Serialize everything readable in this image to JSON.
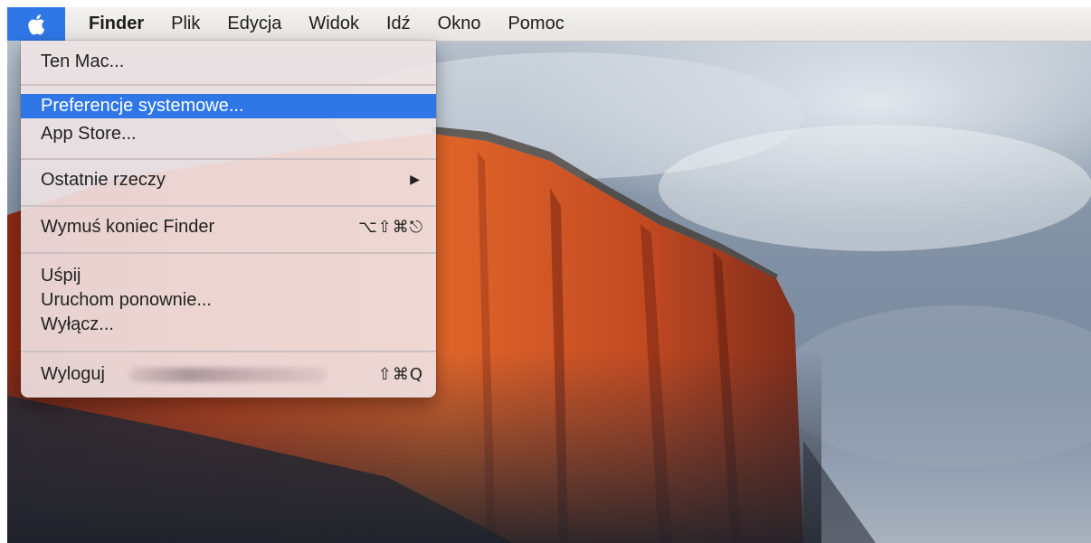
{
  "menubar": {
    "apple_icon": "apple-logo-icon",
    "app_name": "Finder",
    "menus": [
      "Plik",
      "Edycja",
      "Widok",
      "Idź",
      "Okno",
      "Pomoc"
    ]
  },
  "apple_menu": {
    "items": {
      "about": "Ten Mac...",
      "system_prefs": "Preferencje systemowe...",
      "app_store": "App Store...",
      "recent_items": "Ostatnie rzeczy",
      "force_quit": "Wymuś koniec Finder",
      "force_quit_shortcut": "⌥⇧⌘⎋",
      "sleep": "Uśpij",
      "restart": "Uruchom ponownie...",
      "shutdown": "Wyłącz...",
      "logout": "Wyloguj",
      "logout_shortcut": "⇧⌘Q"
    },
    "submenu_arrow": "▶",
    "selected_item": "Preferencje systemowe..."
  },
  "colors": {
    "highlight": "#2f77e6",
    "menubar": "#eceae9",
    "menu_bg": "#f0e4e6"
  }
}
